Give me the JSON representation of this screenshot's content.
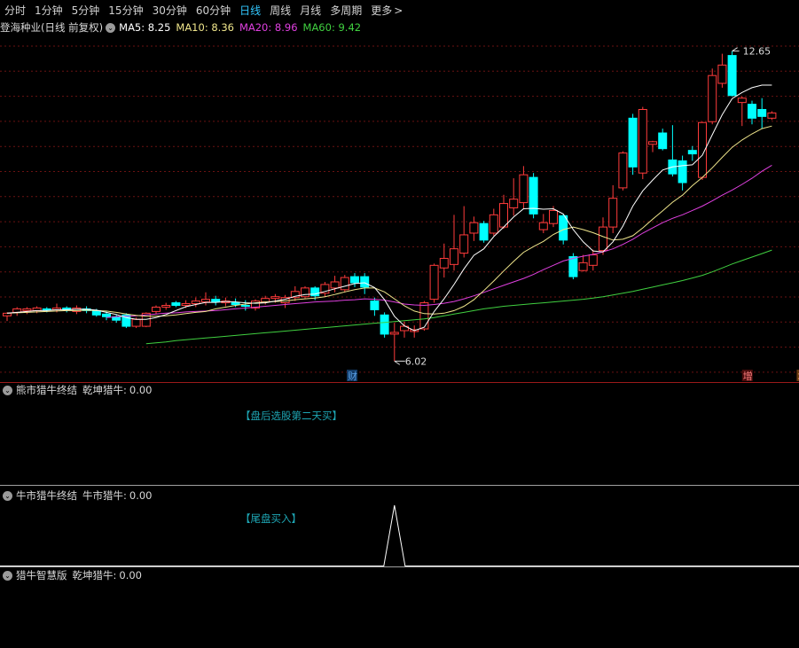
{
  "tabs": [
    {
      "label": "分时",
      "active": false
    },
    {
      "label": "1分钟",
      "active": false
    },
    {
      "label": "5分钟",
      "active": false
    },
    {
      "label": "15分钟",
      "active": false
    },
    {
      "label": "30分钟",
      "active": false
    },
    {
      "label": "60分钟",
      "active": false
    },
    {
      "label": "日线",
      "active": true
    },
    {
      "label": "周线",
      "active": false
    },
    {
      "label": "月线",
      "active": false
    },
    {
      "label": "多周期",
      "active": false
    },
    {
      "label": "更多",
      "active": false
    }
  ],
  "more_chevron": ">",
  "main": {
    "stock_title": "登海种业(日线 前复权)",
    "dropdown_icon": "chevron-down-icon",
    "ma": [
      {
        "label": "MA5:",
        "value": "8.25",
        "color": "#ffffff"
      },
      {
        "label": "MA10:",
        "value": "8.36",
        "color": "#f0e68c"
      },
      {
        "label": "MA20:",
        "value": "8.96",
        "color": "#e040e0"
      },
      {
        "label": "MA60:",
        "value": "9.42",
        "color": "#40d040"
      }
    ],
    "high_label": "12.65",
    "low_label": "6.02",
    "markers": [
      {
        "text": "财",
        "color": "#5aa0e6",
        "bg": "#123a66"
      },
      {
        "text": "增",
        "color": "#ff8080",
        "bg": "#4a0c0c"
      },
      {
        "text": "增",
        "color": "#ffb060",
        "bg": "#6a3a10"
      }
    ]
  },
  "panel1": {
    "title": "熊市猎牛终结",
    "indicator": "乾坤猎牛:",
    "value": "0.00",
    "note": "【盘后选股第二天买】"
  },
  "panel2": {
    "title": "牛市猎牛终结",
    "indicator": "牛市猎牛:",
    "value": "0.00",
    "note": "【尾盘买入】"
  },
  "panel3": {
    "title": "猎牛智慧版",
    "indicator": "乾坤猎牛:",
    "value": "0.00"
  },
  "colors": {
    "up": "#ff3b3b",
    "down": "#00ffff",
    "ma5": "#ffffff",
    "ma10": "#f0e68c",
    "ma20": "#e040e0",
    "ma60": "#40d040",
    "grid": "#6a1212"
  },
  "chart_data": {
    "type": "candlestick",
    "ylim": [
      5.6,
      13.5
    ],
    "candles": [
      [
        7.06,
        7.12,
        6.94,
        7.14
      ],
      [
        7.14,
        7.22,
        7.06,
        7.26
      ],
      [
        7.18,
        7.22,
        7.1,
        7.26
      ],
      [
        7.18,
        7.24,
        7.12,
        7.28
      ],
      [
        7.22,
        7.2,
        7.14,
        7.26
      ],
      [
        7.2,
        7.24,
        7.14,
        7.34
      ],
      [
        7.24,
        7.2,
        7.14,
        7.28
      ],
      [
        7.16,
        7.24,
        7.1,
        7.3
      ],
      [
        7.22,
        7.18,
        7.12,
        7.28
      ],
      [
        7.18,
        7.08,
        7.04,
        7.22
      ],
      [
        7.1,
        7.04,
        6.96,
        7.16
      ],
      [
        7.04,
        6.96,
        6.9,
        7.1
      ],
      [
        7.08,
        6.82,
        6.78,
        7.12
      ],
      [
        6.82,
        6.98,
        6.78,
        7.02
      ],
      [
        6.82,
        7.12,
        6.8,
        7.14
      ],
      [
        7.16,
        7.26,
        7.1,
        7.3
      ],
      [
        7.26,
        7.3,
        7.2,
        7.36
      ],
      [
        7.36,
        7.3,
        7.26,
        7.4
      ],
      [
        7.3,
        7.34,
        7.24,
        7.42
      ],
      [
        7.34,
        7.4,
        7.26,
        7.48
      ],
      [
        7.38,
        7.44,
        7.3,
        7.6
      ],
      [
        7.44,
        7.38,
        7.3,
        7.52
      ],
      [
        7.36,
        7.4,
        7.28,
        7.48
      ],
      [
        7.36,
        7.32,
        7.26,
        7.46
      ],
      [
        7.3,
        7.28,
        7.18,
        7.42
      ],
      [
        7.24,
        7.4,
        7.18,
        7.44
      ],
      [
        7.38,
        7.46,
        7.32,
        7.52
      ],
      [
        7.46,
        7.5,
        7.36,
        7.56
      ],
      [
        7.36,
        7.48,
        7.24,
        7.54
      ],
      [
        7.48,
        7.62,
        7.4,
        7.74
      ],
      [
        7.5,
        7.7,
        7.46,
        7.74
      ],
      [
        7.7,
        7.52,
        7.42,
        7.74
      ],
      [
        7.58,
        7.78,
        7.5,
        7.84
      ],
      [
        7.7,
        7.84,
        7.6,
        7.98
      ],
      [
        7.66,
        7.94,
        7.6,
        8.0
      ],
      [
        7.96,
        7.82,
        7.72,
        8.04
      ],
      [
        7.96,
        7.72,
        7.56,
        8.04
      ],
      [
        7.4,
        7.2,
        7.06,
        7.48
      ],
      [
        7.08,
        6.64,
        6.56,
        7.14
      ],
      [
        6.64,
        6.68,
        6.02,
        6.9
      ],
      [
        6.72,
        6.82,
        6.56,
        6.92
      ],
      [
        6.7,
        6.74,
        6.56,
        6.84
      ],
      [
        6.76,
        7.36,
        6.72,
        7.4
      ],
      [
        7.44,
        8.22,
        7.36,
        8.26
      ],
      [
        8.16,
        8.38,
        7.94,
        8.72
      ],
      [
        8.24,
        8.6,
        8.1,
        9.38
      ],
      [
        8.5,
        8.92,
        8.4,
        9.58
      ],
      [
        8.96,
        9.2,
        8.78,
        9.34
      ],
      [
        9.18,
        8.8,
        8.74,
        9.24
      ],
      [
        8.96,
        9.38,
        8.9,
        9.52
      ],
      [
        9.1,
        9.64,
        9.06,
        9.84
      ],
      [
        9.54,
        9.74,
        9.36,
        10.22
      ],
      [
        9.66,
        10.3,
        9.52,
        10.5
      ],
      [
        10.24,
        9.4,
        9.3,
        10.34
      ],
      [
        9.04,
        9.2,
        8.96,
        9.4
      ],
      [
        9.18,
        9.48,
        9.1,
        9.58
      ],
      [
        9.36,
        8.8,
        8.7,
        9.4
      ],
      [
        8.42,
        7.96,
        7.9,
        8.5
      ],
      [
        8.1,
        8.28,
        8.08,
        8.46
      ],
      [
        8.22,
        8.46,
        8.1,
        8.58
      ],
      [
        8.56,
        9.1,
        8.46,
        9.32
      ],
      [
        9.1,
        9.76,
        8.96,
        10.06
      ],
      [
        10.0,
        10.8,
        9.94,
        10.84
      ],
      [
        11.6,
        10.48,
        10.3,
        11.7
      ],
      [
        10.34,
        11.8,
        10.2,
        11.86
      ],
      [
        11.0,
        11.06,
        10.82,
        11.08
      ],
      [
        11.26,
        10.9,
        10.86,
        11.36
      ],
      [
        10.64,
        10.32,
        10.26,
        11.44
      ],
      [
        10.62,
        10.12,
        9.94,
        10.74
      ],
      [
        10.86,
        10.78,
        10.62,
        10.96
      ],
      [
        10.24,
        11.5,
        10.18,
        11.52
      ],
      [
        11.52,
        12.58,
        11.46,
        12.74
      ],
      [
        12.4,
        12.82,
        12.3,
        13.08
      ],
      [
        13.04,
        12.12,
        12.1,
        13.14
      ],
      [
        11.96,
        12.06,
        11.42,
        12.1
      ],
      [
        11.92,
        11.6,
        11.46,
        12.0
      ],
      [
        11.8,
        11.64,
        11.36,
        12.06
      ],
      [
        11.6,
        11.72,
        11.56,
        11.76
      ]
    ],
    "ma5": [
      7.12,
      7.14,
      7.16,
      7.18,
      7.18,
      7.2,
      7.2,
      7.21,
      7.21,
      7.19,
      7.14,
      7.09,
      7.02,
      6.98,
      6.98,
      7.02,
      7.09,
      7.18,
      7.27,
      7.32,
      7.37,
      7.37,
      7.39,
      7.38,
      7.36,
      7.35,
      7.36,
      7.4,
      7.44,
      7.51,
      7.55,
      7.56,
      7.62,
      7.68,
      7.74,
      7.8,
      7.82,
      7.71,
      7.43,
      7.05,
      6.83,
      6.72,
      6.8,
      7.16,
      7.45,
      7.78,
      8.14,
      8.45,
      8.6,
      8.88,
      9.1,
      9.33,
      9.52,
      9.53,
      9.51,
      9.52,
      9.4,
      9.04,
      8.76,
      8.55,
      8.53,
      8.76,
      9.12,
      9.58,
      9.93,
      10.18,
      10.41,
      10.48,
      10.51,
      10.53,
      10.75,
      11.22,
      11.68,
      12.05,
      12.19,
      12.3,
      12.36,
      12.36
    ],
    "ma10": [
      7.12,
      7.13,
      7.14,
      7.15,
      7.16,
      7.17,
      7.18,
      7.18,
      7.19,
      7.18,
      7.17,
      7.14,
      7.1,
      7.07,
      7.05,
      7.05,
      7.06,
      7.08,
      7.11,
      7.14,
      7.16,
      7.22,
      7.26,
      7.3,
      7.33,
      7.36,
      7.38,
      7.39,
      7.4,
      7.43,
      7.45,
      7.47,
      7.5,
      7.55,
      7.61,
      7.66,
      7.7,
      7.7,
      7.61,
      7.45,
      7.29,
      7.17,
      7.11,
      7.1,
      7.12,
      7.18,
      7.28,
      7.43,
      7.64,
      7.86,
      8.09,
      8.31,
      8.52,
      8.65,
      8.77,
      8.93,
      9.04,
      9.1,
      9.04,
      8.97,
      8.88,
      8.8,
      8.82,
      8.9,
      9.08,
      9.28,
      9.47,
      9.67,
      9.83,
      10.05,
      10.24,
      10.46,
      10.7,
      10.93,
      11.1,
      11.24,
      11.36,
      11.42
    ],
    "ma20": [
      null,
      null,
      null,
      null,
      null,
      null,
      null,
      null,
      null,
      null,
      7.02,
      7.04,
      7.05,
      7.06,
      7.08,
      7.1,
      7.12,
      7.13,
      7.15,
      7.16,
      7.17,
      7.18,
      7.2,
      7.22,
      7.24,
      7.26,
      7.28,
      7.3,
      7.32,
      7.34,
      7.36,
      7.38,
      7.39,
      7.4,
      7.42,
      7.43,
      7.45,
      7.44,
      7.42,
      7.38,
      7.33,
      7.31,
      7.3,
      7.32,
      7.35,
      7.39,
      7.45,
      7.52,
      7.6,
      7.68,
      7.76,
      7.84,
      7.92,
      8.01,
      8.12,
      8.22,
      8.32,
      8.38,
      8.43,
      8.47,
      8.53,
      8.6,
      8.7,
      8.82,
      8.96,
      9.08,
      9.2,
      9.3,
      9.38,
      9.48,
      9.58,
      9.7,
      9.83,
      9.95,
      10.08,
      10.22,
      10.38,
      10.52
    ],
    "ma60": [
      null,
      null,
      null,
      null,
      null,
      null,
      null,
      null,
      null,
      null,
      null,
      null,
      null,
      null,
      6.42,
      6.44,
      6.46,
      6.49,
      6.51,
      6.53,
      6.55,
      6.57,
      6.59,
      6.61,
      6.63,
      6.65,
      6.67,
      6.69,
      6.71,
      6.73,
      6.75,
      6.77,
      6.79,
      6.81,
      6.83,
      6.85,
      6.87,
      6.89,
      6.91,
      6.93,
      6.95,
      6.97,
      6.99,
      7.02,
      7.06,
      7.1,
      7.14,
      7.18,
      7.22,
      7.25,
      7.28,
      7.3,
      7.32,
      7.34,
      7.36,
      7.38,
      7.4,
      7.42,
      7.44,
      7.47,
      7.5,
      7.54,
      7.58,
      7.62,
      7.67,
      7.72,
      7.77,
      7.82,
      7.87,
      7.93,
      7.99,
      8.07,
      8.16,
      8.25,
      8.33,
      8.41,
      8.49,
      8.57
    ],
    "signal_panel2": {
      "peak_index": 39,
      "peak_value": 1
    }
  }
}
